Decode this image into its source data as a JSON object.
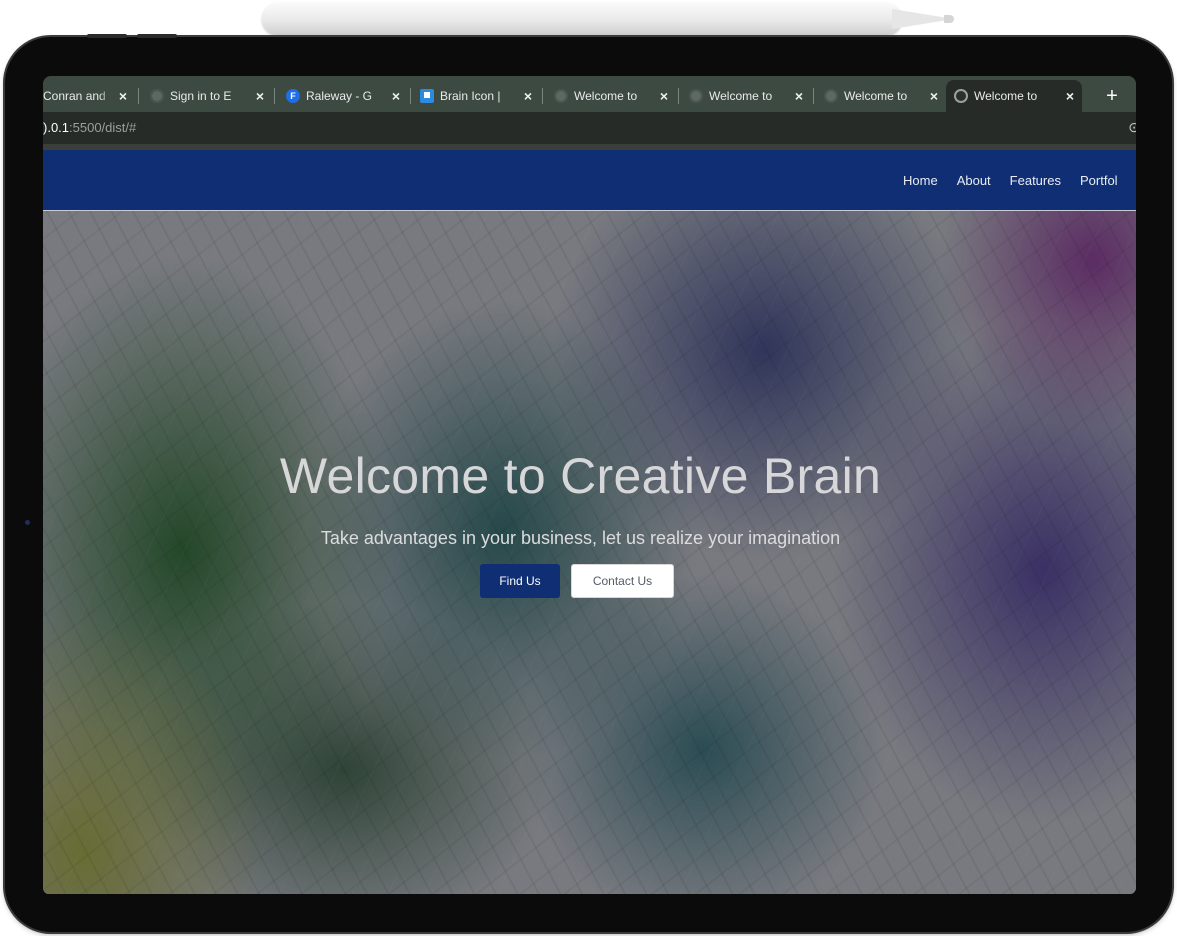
{
  "browser": {
    "tabs": [
      {
        "title": "Conran and",
        "favicon": "none",
        "active": false
      },
      {
        "title": "Sign in to E",
        "favicon": "globe-icon",
        "active": false
      },
      {
        "title": "Raleway - G",
        "favicon": "fonts-f-icon",
        "active": false
      },
      {
        "title": "Brain Icon |",
        "favicon": "flag-icon",
        "active": false
      },
      {
        "title": "Welcome to",
        "favicon": "globe-icon",
        "active": false
      },
      {
        "title": "Welcome to",
        "favicon": "globe-icon",
        "active": false
      },
      {
        "title": "Welcome to",
        "favicon": "globe-icon",
        "active": false
      },
      {
        "title": "Welcome to",
        "favicon": "globe-icon",
        "active": true
      }
    ],
    "close_glyph": "×",
    "new_tab_glyph": "+",
    "address": {
      "host": ").0.1",
      "path": ":5500/dist/#"
    },
    "address_icon_glyph": "⊙"
  },
  "site": {
    "nav": [
      "Home",
      "About",
      "Features",
      "Portfol"
    ],
    "hero": {
      "title": "Welcome to Creative Brain",
      "subtitle": "Take advantages in your business, let us realize your imagination",
      "primary_button": "Find Us",
      "secondary_button": "Contact Us"
    }
  },
  "colors": {
    "navbar": "#0f2e73",
    "primary_button": "#0f2e73",
    "tab_strip": "#3d4a42",
    "address_bar": "#262b27"
  }
}
